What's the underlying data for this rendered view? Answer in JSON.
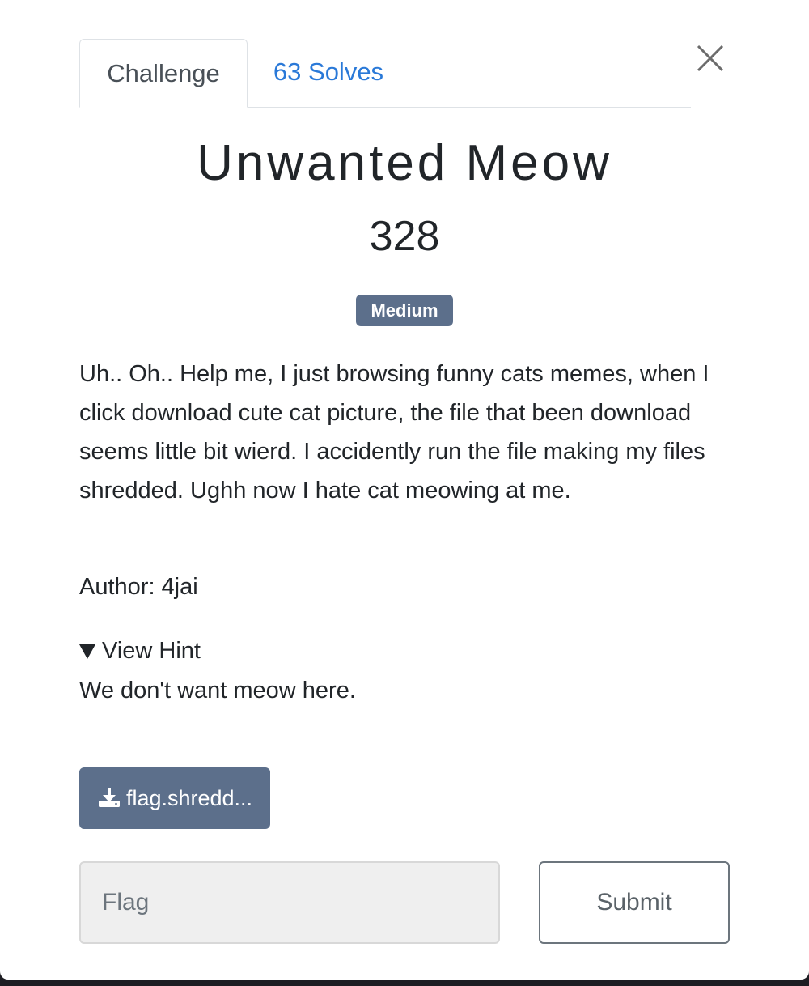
{
  "tabs": {
    "challenge": "Challenge",
    "solves": "63 Solves"
  },
  "challenge": {
    "title": "Unwanted Meow",
    "points": "328",
    "difficulty": "Medium",
    "description": "Uh.. Oh.. Help me, I just browsing funny cats memes, when I click download cute cat picture, the file that been download seems little bit wierd. I accidently run the file making my files shredded. Ughh now I hate cat meowing at me.",
    "author": "Author: 4jai",
    "hint_label": "View Hint",
    "hint_text": "We don't want meow here."
  },
  "download": {
    "label": "flag.shredd...",
    "icon": "download-icon"
  },
  "flag_form": {
    "placeholder": "Flag",
    "value": "",
    "submit_label": "Submit"
  },
  "colors": {
    "accent_link": "#2a79d8",
    "badge_bg": "#5c6f8b",
    "button_bg": "#5c6f8b"
  }
}
